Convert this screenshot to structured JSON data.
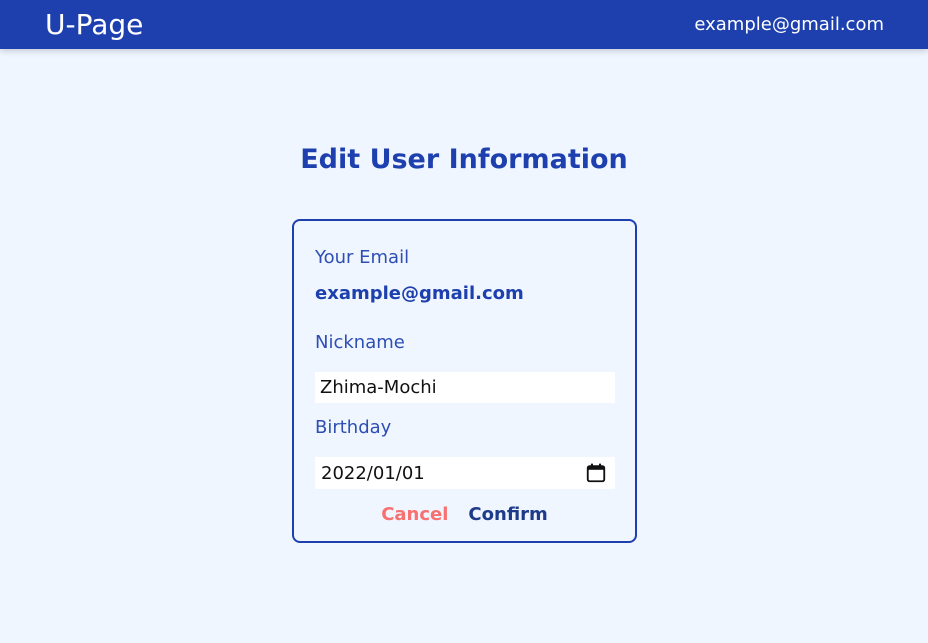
{
  "header": {
    "brand": "U-Page",
    "user_email": "example@gmail.com"
  },
  "page": {
    "title": "Edit User Information"
  },
  "form": {
    "email_label": "Your Email",
    "email_value": "example@gmail.com",
    "nickname_label": "Nickname",
    "nickname_value": "Zhima-Mochi",
    "birthday_label": "Birthday",
    "birthday_value": "2022/01/01",
    "cancel_label": "Cancel",
    "confirm_label": "Confirm"
  },
  "icons": {
    "calendar": "calendar-icon"
  },
  "colors": {
    "primary": "#1e40af",
    "background": "#eff6ff",
    "cancel": "#f87171",
    "confirm": "#1e3a8a"
  }
}
